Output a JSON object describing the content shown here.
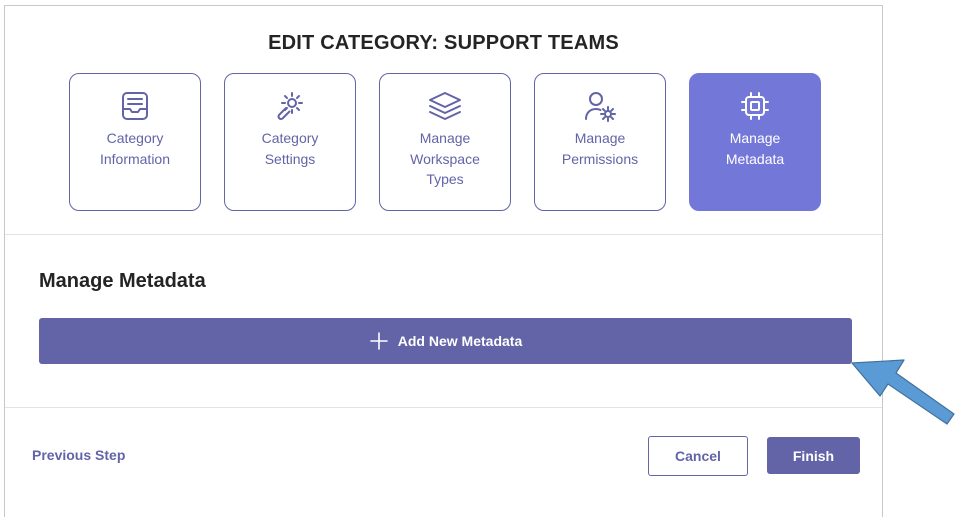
{
  "dialog": {
    "title": "EDIT CATEGORY: SUPPORT TEAMS"
  },
  "steps": [
    {
      "label": "Category\nInformation",
      "icon": "inbox-tray-icon",
      "active": false
    },
    {
      "label": "Category\nSettings",
      "icon": "wrench-gear-icon",
      "active": false
    },
    {
      "label": "Manage\nWorkspace\nTypes",
      "icon": "layers-icon",
      "active": false
    },
    {
      "label": "Manage\nPermissions",
      "icon": "user-gear-icon",
      "active": false
    },
    {
      "label": "Manage\nMetadata",
      "icon": "chip-icon",
      "active": true
    }
  ],
  "section": {
    "title": "Manage Metadata",
    "add_button_label": "Add New Metadata",
    "add_button_icon": "plus-icon"
  },
  "footer": {
    "previous_label": "Previous Step",
    "cancel_label": "Cancel",
    "finish_label": "Finish"
  },
  "annotation": {
    "icon": "pointer-arrow-icon",
    "color": "#5b9bd5"
  },
  "colors": {
    "accent": "#6264a7",
    "active_tile": "#7378d8"
  }
}
